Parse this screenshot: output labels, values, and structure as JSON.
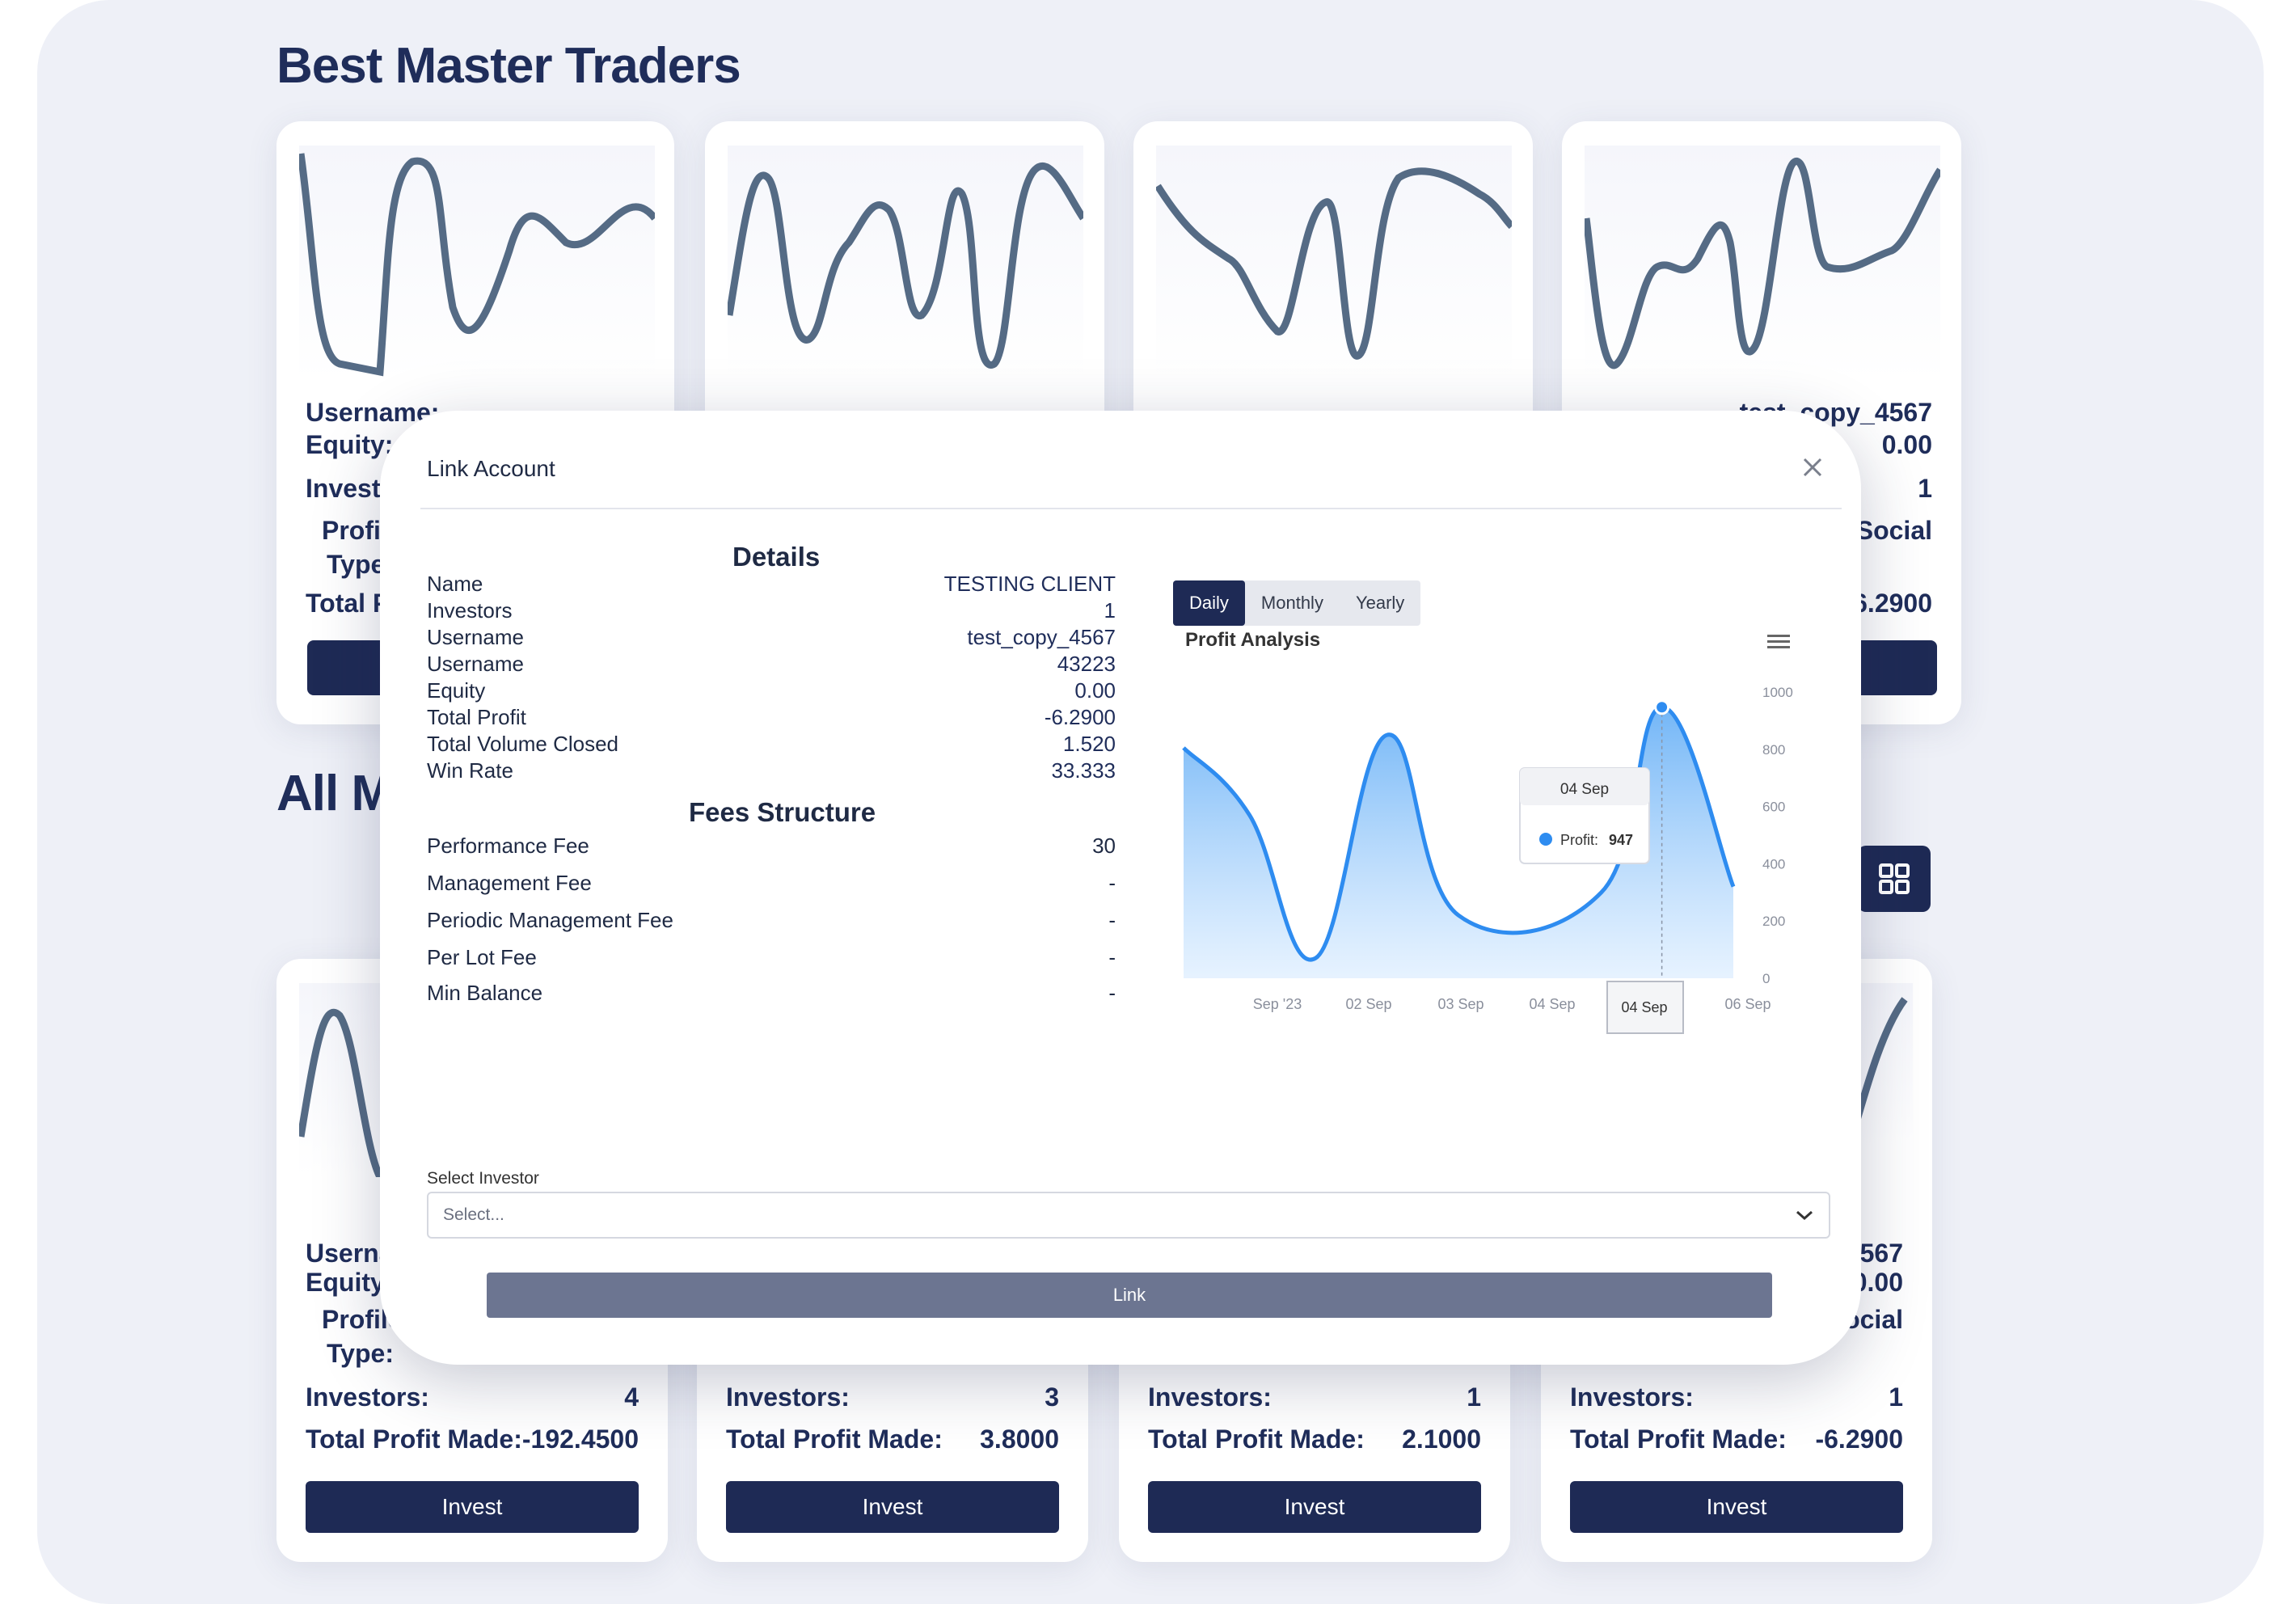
{
  "page": {
    "best_title": "Best Master Traders",
    "all_title": "All M"
  },
  "top_cards": [
    {
      "username_label": "Username:",
      "equity_label": "Equity:",
      "investors_label": "Investo",
      "profile_label": "Profil",
      "type_label": "Type",
      "total_label": "Total P"
    },
    {
      "username_label": "",
      "equity_label": "",
      "investors_label": "",
      "profile_label": "",
      "type_label": "",
      "total_label": ""
    },
    {
      "username_label": "",
      "equity_label": "",
      "investors_label": "",
      "profile_label": "",
      "type_label": "",
      "total_label": ""
    },
    {
      "username_value": "test_copy_4567",
      "equity_value": "0.00",
      "investors_value": "1",
      "profile_value": "Social",
      "total_value": "6.2900"
    }
  ],
  "bottom_cards": [
    {
      "username_label": "Userna",
      "equity_label": "Equity:",
      "profile_label": "Profile",
      "type_label": "Type:",
      "investors_label": "Investors:",
      "investors_value": "4",
      "total_label": "Total Profit Made:",
      "total_value": "-192.4500",
      "invest_label": "Invest"
    },
    {
      "investors_label": "Investors:",
      "investors_value": "3",
      "total_label": "Total Profit Made:",
      "total_value": "3.8000",
      "invest_label": "Invest"
    },
    {
      "investors_label": "Investors:",
      "investors_value": "1",
      "total_label": "Total Profit Made:",
      "total_value": "2.1000",
      "invest_label": "Invest"
    },
    {
      "username_value": "567",
      "equity_value": "0.00",
      "profile_value": "ocial",
      "investors_label": "Investors:",
      "investors_value": "1",
      "total_label": "Total Profit Made:",
      "total_value": "-6.2900",
      "invest_label": "Invest"
    }
  ],
  "modal": {
    "title": "Link Account",
    "details_heading": "Details",
    "details": [
      {
        "label": "Name",
        "value": "TESTING CLIENT"
      },
      {
        "label": "Investors",
        "value": "1"
      },
      {
        "label": "Username",
        "value": "test_copy_4567"
      },
      {
        "label": "Username",
        "value": "43223"
      },
      {
        "label": "Equity",
        "value": "0.00"
      },
      {
        "label": "Total Profit",
        "value": "-6.2900"
      },
      {
        "label": "Total Volume Closed",
        "value": "1.520"
      },
      {
        "label": "Win Rate",
        "value": "33.333"
      }
    ],
    "fees_heading": "Fees Structure",
    "fees": [
      {
        "label": "Performance Fee",
        "value": "30"
      },
      {
        "label": "Management Fee",
        "value": "-"
      },
      {
        "label": "Periodic Management Fee",
        "value": "-"
      },
      {
        "label": "Per Lot Fee",
        "value": "-"
      },
      {
        "label": "Min Balance",
        "value": "-"
      }
    ],
    "tabs": [
      "Daily",
      "Monthly",
      "Yearly"
    ],
    "active_tab": "Daily",
    "select_label": "Select Investor",
    "select_placeholder": "Select...",
    "link_label": "Link"
  },
  "chart_data": {
    "type": "area",
    "title": "Profit Analysis",
    "x_ticks": [
      "Sep '23",
      "02 Sep",
      "03 Sep",
      "04 Sep",
      "04 Sep",
      "06 Sep"
    ],
    "y_ticks": [
      "1000",
      "800",
      "600",
      "400",
      "200",
      "0"
    ],
    "ylim": [
      0,
      1000
    ],
    "series": [
      {
        "name": "Profit",
        "x": [
          0,
          0.6,
          1.2,
          1.85,
          2.5,
          3.8,
          4.35,
          5.0
        ],
        "values": [
          805,
          570,
          70,
          850,
          220,
          300,
          947,
          320
        ]
      }
    ],
    "tooltip": {
      "date": "04 Sep",
      "series": "Profit",
      "value": "947"
    },
    "color": "#2e8cf0"
  }
}
